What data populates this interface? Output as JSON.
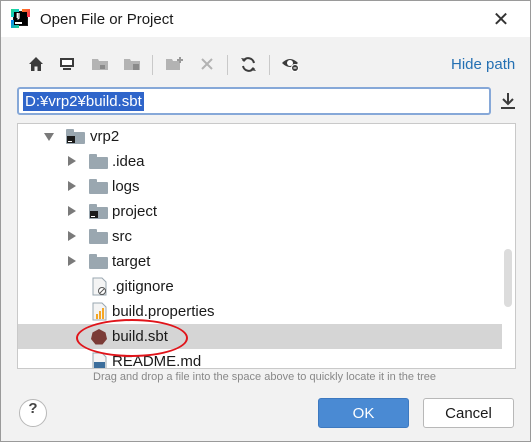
{
  "window": {
    "title": "Open File or Project"
  },
  "toolbar": {
    "hide_path_label": "Hide path"
  },
  "path": {
    "value": "D:¥vrp2¥build.sbt"
  },
  "tree": {
    "root": {
      "label": "vrp2"
    },
    "items": [
      {
        "label": ".idea"
      },
      {
        "label": "logs"
      },
      {
        "label": "project"
      },
      {
        "label": "src"
      },
      {
        "label": "target"
      },
      {
        "label": ".gitignore"
      },
      {
        "label": "build.properties"
      },
      {
        "label": "build.sbt"
      },
      {
        "label": "README.md"
      }
    ]
  },
  "hint": "Drag and drop a file into the space above to quickly locate it in the tree",
  "buttons": {
    "help": "?",
    "ok": "OK",
    "cancel": "Cancel"
  },
  "colors": {
    "accent": "#4a8ad3",
    "selection": "#2f65ca",
    "annotation": "#e0141a",
    "link": "#2470b3"
  }
}
